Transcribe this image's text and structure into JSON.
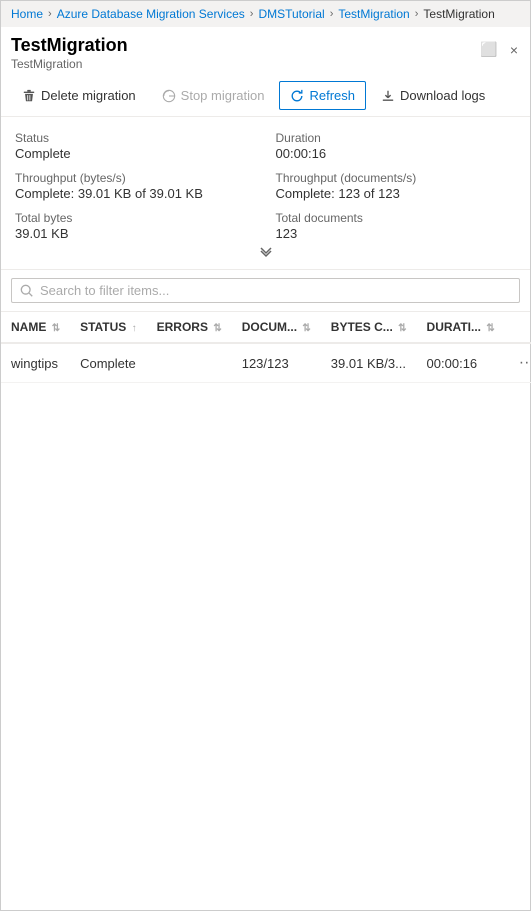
{
  "breadcrumb": {
    "items": [
      {
        "label": "Home",
        "active": true
      },
      {
        "label": "Azure Database Migration Services",
        "active": true
      },
      {
        "label": "DMSTutorial",
        "active": true
      },
      {
        "label": "TestMigration",
        "active": true
      },
      {
        "label": "TestMigration",
        "active": false
      }
    ],
    "separator": ">"
  },
  "header": {
    "title": "TestMigration",
    "subtitle": "TestMigration",
    "close_label": "×",
    "resize_label": "⬜"
  },
  "toolbar": {
    "delete_label": "Delete migration",
    "stop_label": "Stop migration",
    "refresh_label": "Refresh",
    "download_label": "Download logs"
  },
  "info": {
    "status_label": "Status",
    "status_value": "Complete",
    "duration_label": "Duration",
    "duration_value": "00:00:16",
    "throughput_bytes_label": "Throughput (bytes/s)",
    "throughput_bytes_value": "Complete: 39.01 KB of 39.01 KB",
    "throughput_docs_label": "Throughput (documents/s)",
    "throughput_docs_value": "Complete: 123 of 123",
    "total_bytes_label": "Total bytes",
    "total_bytes_value": "39.01 KB",
    "total_docs_label": "Total documents",
    "total_docs_value": "123"
  },
  "search": {
    "placeholder": "Search to filter items..."
  },
  "table": {
    "columns": [
      {
        "key": "name",
        "label": "NAME"
      },
      {
        "key": "status",
        "label": "STATUS"
      },
      {
        "key": "errors",
        "label": "ERRORS"
      },
      {
        "key": "documents",
        "label": "DOCUM..."
      },
      {
        "key": "bytes",
        "label": "BYTES C..."
      },
      {
        "key": "duration",
        "label": "DURATI..."
      }
    ],
    "rows": [
      {
        "name": "wingtips",
        "status": "Complete",
        "errors": "",
        "documents": "123/123",
        "bytes": "39.01 KB/3...",
        "duration": "00:00:16"
      }
    ]
  }
}
